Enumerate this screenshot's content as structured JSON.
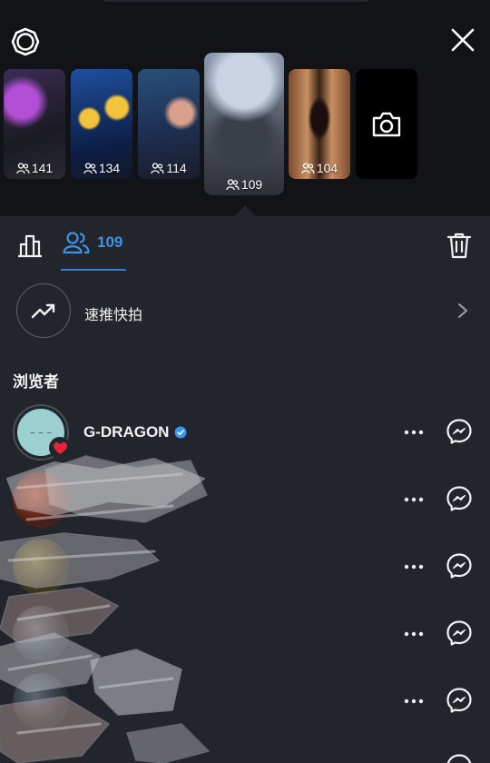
{
  "stories": [
    {
      "id": "story-1",
      "viewers": "141"
    },
    {
      "id": "story-2",
      "viewers": "134"
    },
    {
      "id": "story-3",
      "viewers": "114"
    },
    {
      "id": "story-4",
      "viewers": "109",
      "active": true
    },
    {
      "id": "story-5",
      "viewers": "104"
    }
  ],
  "tabs": {
    "viewers_count": "109"
  },
  "promote": {
    "label": "速推快拍"
  },
  "viewers_section": {
    "title": "浏览者",
    "list": [
      {
        "username": "G-DRAGON",
        "verified": true,
        "liked": true
      },
      {
        "username": ""
      },
      {
        "username": ""
      },
      {
        "username": ""
      },
      {
        "username": ""
      }
    ]
  },
  "colors": {
    "accent": "#3d93e6",
    "panel": "#22252b",
    "top_bg": "#111317",
    "heart": "#e8223a",
    "verified": "#3797f0"
  },
  "icons": [
    "settings-icon",
    "close-icon",
    "camera-icon",
    "bar-chart-icon",
    "people-icon",
    "trash-icon",
    "trending-up-icon",
    "chevron-right-icon",
    "heart-icon",
    "verified-icon",
    "more-icon",
    "messenger-icon"
  ]
}
